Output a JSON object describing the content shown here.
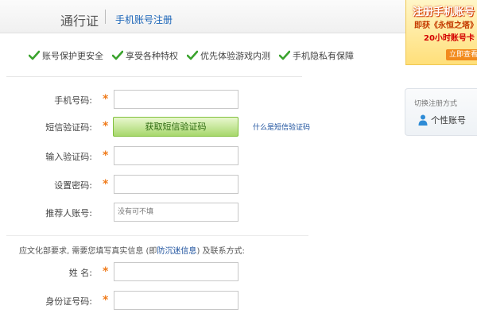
{
  "header": {
    "brand": "通行证",
    "subtitle": "手机账号注册"
  },
  "promo": {
    "title": "注册手机账号",
    "line2": "即获《永恒之塔》",
    "line3": "20小时账号卡",
    "button": "立即查看"
  },
  "benefits": [
    {
      "label": "账号保护更安全"
    },
    {
      "label": "享受各种特权"
    },
    {
      "label": "优先体验游戏内测"
    },
    {
      "label": "手机隐私有保障"
    }
  ],
  "form": {
    "phone_label": "手机号码:",
    "sms_code_label": "短信验证码:",
    "sms_button": "获取短信验证码",
    "sms_help_link": "什么是短信验证码",
    "verify_code_label": "输入验证码:",
    "password_label": "设置密码:",
    "referrer_label": "推荐人账号:",
    "referrer_placeholder": "没有可不填",
    "name_label": "姓 名:",
    "id_label": "身份证号码:",
    "required_mark": "*"
  },
  "notice": {
    "prefix": "应文化部要求, 需要您填写真实信息 (即",
    "link": "防沉迷信息",
    "suffix": ") 及联系方式:"
  },
  "switch": {
    "title": "切换注册方式",
    "option": "个性账号"
  },
  "colors": {
    "link": "#1a64b8",
    "check": "#3aa32d",
    "star": "#f07b1b",
    "button_green": "#a7d86c"
  }
}
